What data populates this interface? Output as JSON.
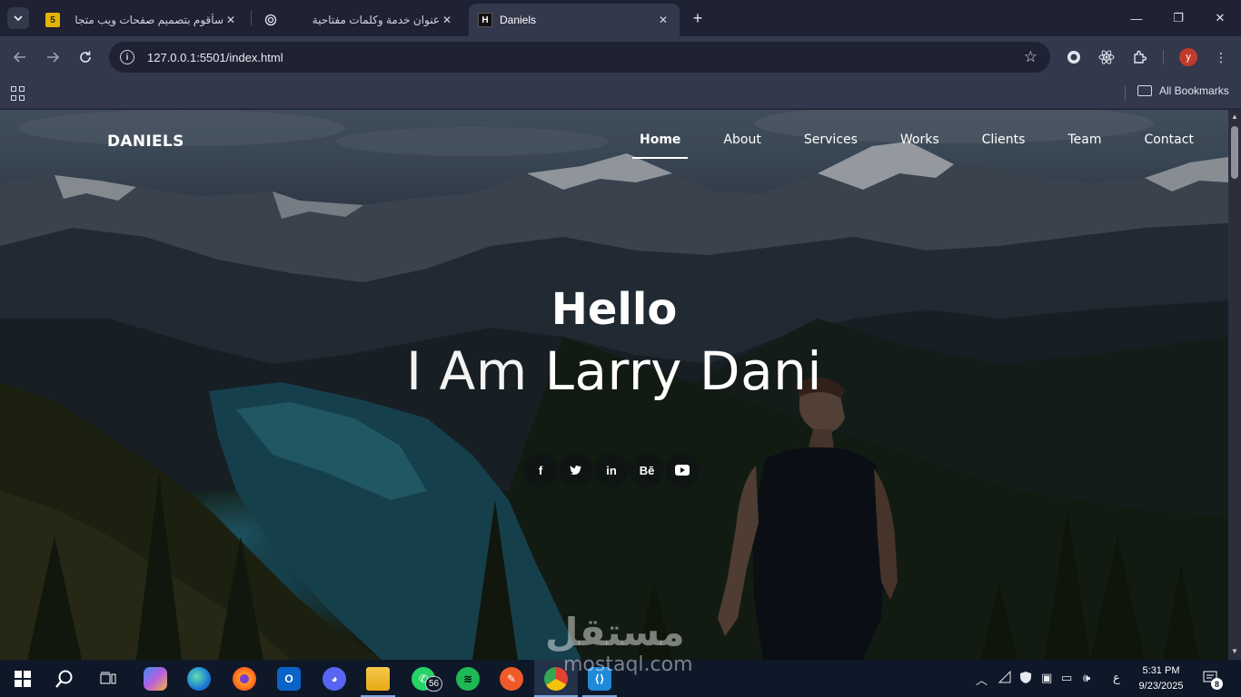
{
  "browser": {
    "tabs": [
      {
        "favicon": "5",
        "title": "سأقوم بتصميم صفحات ويب متجا",
        "close": "✕"
      },
      {
        "favicon": "openai-icon",
        "title": "عنوان خدمة وكلمات مفتاحية",
        "close": "✕"
      },
      {
        "favicon": "H",
        "title": "Daniels",
        "close": "✕",
        "active": true
      }
    ],
    "new_tab": "+",
    "window_controls": {
      "minimize": "—",
      "restore": "❐",
      "close": "✕"
    },
    "url": "127.0.0.1:5501/index.html",
    "profile_initial": "y",
    "bookmarks_label": "All Bookmarks"
  },
  "site": {
    "brand": "DANIELS",
    "nav": [
      "Home",
      "About",
      "Services",
      "Works",
      "Clients",
      "Team",
      "Contact"
    ],
    "active_nav": "Home",
    "hero": {
      "greeting": "Hello",
      "intro": "I Am",
      "name": "Larry Dani"
    },
    "socials": [
      {
        "icon": "facebook-icon",
        "glyph": "f"
      },
      {
        "icon": "twitter-icon",
        "glyph": "🐦"
      },
      {
        "icon": "linkedin-icon",
        "glyph": "in"
      },
      {
        "icon": "behance-icon",
        "glyph": "Bē"
      },
      {
        "icon": "youtube-icon",
        "glyph": "▶"
      }
    ]
  },
  "watermark": {
    "arabic": "مستقل",
    "latin": "mostaql.com"
  },
  "taskbar": {
    "whatsapp_badge": "56",
    "time": "5:31 PM",
    "date": "9/23/2025",
    "language": "ع",
    "notifications": "8"
  }
}
